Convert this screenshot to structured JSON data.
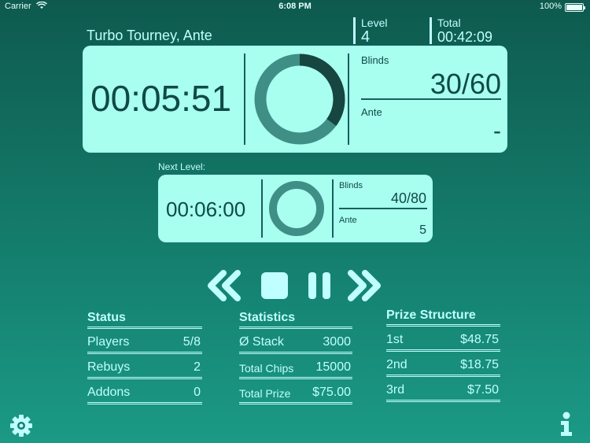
{
  "statusbar": {
    "carrier": "Carrier",
    "time": "6:08 PM",
    "battery": "100%"
  },
  "tournament": {
    "title": "Turbo Tourney, Ante",
    "level_label": "Level",
    "level_value": "4",
    "total_label": "Total",
    "total_value": "00:42:09"
  },
  "current": {
    "clock": "00:05:51",
    "progress_fraction": 0.35,
    "blinds_label": "Blinds",
    "blinds_value": "30/60",
    "ante_label": "Ante",
    "ante_value": "-"
  },
  "next": {
    "label": "Next Level:",
    "clock": "00:06:00",
    "progress_fraction": 0,
    "blinds_label": "Blinds",
    "blinds_value": "40/80",
    "ante_label": "Ante",
    "ante_value": "5"
  },
  "controls": {
    "rewind": "rewind-icon",
    "stop": "stop-icon",
    "pause": "pause-icon",
    "forward": "fast-forward-icon"
  },
  "status": {
    "heading": "Status",
    "rows": [
      {
        "label": "Players",
        "value": "5/8"
      },
      {
        "label": "Rebuys",
        "value": "2"
      },
      {
        "label": "Addons",
        "value": "0"
      }
    ]
  },
  "statistics": {
    "heading": "Statistics",
    "rows": [
      {
        "label": "Ø Stack",
        "value": "3000"
      },
      {
        "label": "Total Chips",
        "value": "15000"
      },
      {
        "label": "Total Prize",
        "value": "$75.00"
      }
    ]
  },
  "prizes": {
    "heading": "Prize Structure",
    "rows": [
      {
        "label": "1st",
        "value": "$48.75"
      },
      {
        "label": "2nd",
        "value": "$18.75"
      },
      {
        "label": "3rd",
        "value": "$7.50"
      }
    ]
  },
  "colors": {
    "accent": "#bfffff",
    "card": "#a8fff0",
    "card_text": "#0f4a44",
    "ring_track": "#3f8f86",
    "ring_progress": "#17453f"
  },
  "icons": {
    "settings": "gear-icon",
    "info": "info-icon"
  }
}
